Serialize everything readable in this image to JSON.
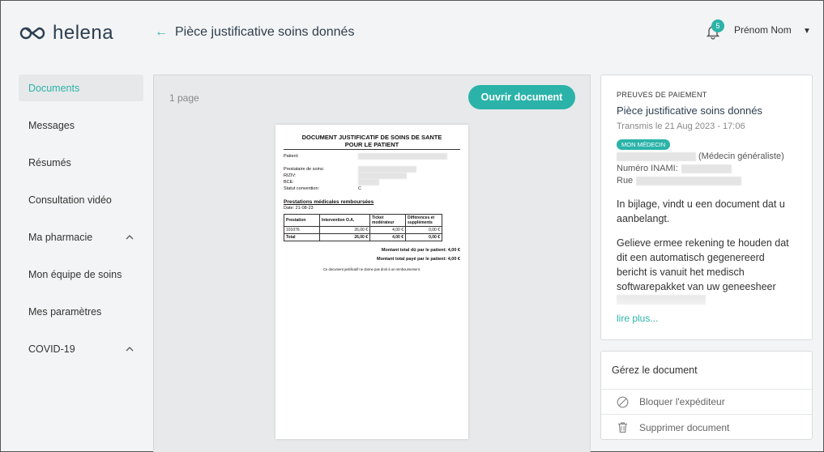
{
  "app": {
    "name": "helena"
  },
  "header": {
    "back_arrow": "←",
    "title": "Pièce justificative soins donnés",
    "notifications": "5",
    "user_name": "Prénom Nom"
  },
  "sidebar": {
    "items": [
      {
        "label": "Documents",
        "active": true
      },
      {
        "label": "Messages"
      },
      {
        "label": "Résumés"
      },
      {
        "label": "Consultation vidéo"
      },
      {
        "label": "Ma pharmacie",
        "expandable": true
      },
      {
        "label": "Mon équipe de soins"
      },
      {
        "label": "Mes paramètres"
      },
      {
        "label": "COVID-19",
        "expandable": true
      }
    ]
  },
  "viewer": {
    "page_count": "1 page",
    "open_button": "Ouvrir document"
  },
  "document": {
    "title_line1": "DOCUMENT JUSTIFICATIF DE SOINS DE SANTE",
    "title_line2": "POUR LE PATIENT",
    "patient_label": "Patient:",
    "provider_label": "Prestataire de soins:",
    "riziv_label": "RIZIV:",
    "bce_label": "BCE:",
    "statut_label": "Statut convention:",
    "statut_value": "C",
    "section_title": "Prestations médicales remboursées",
    "date": "Date: 21-08-23",
    "table": {
      "headers": [
        "Prestation",
        "Intervention O.A.",
        "Ticket modérateur",
        "Différences et suppléments"
      ],
      "rows": [
        [
          "101076",
          "26,00 €",
          "4,00 €",
          "0,00 €"
        ]
      ],
      "total": [
        "Total",
        "26,00 €",
        "4,00 €",
        "0,00 €"
      ]
    },
    "total_due": "Montant total dû par le patient: 4,00 €",
    "total_paid": "Montant total payé par le patient: 4,00 €",
    "note": "Ce document justificatif ne donne pas droit à un remboursement."
  },
  "detail": {
    "label": "PREUVES DE PAIEMENT",
    "title": "Pièce justificative soins donnés",
    "date": "Transmis le 21 Aug 2023 - 17:06",
    "tag": "MON MÉDECIN",
    "doctor_role": "(Médecin généraliste)",
    "inami_label": "Numéro INAMI:",
    "street_label": "Rue",
    "message_p1": "In bijlage, vindt u een document dat u aanbelangt.",
    "message_p2": "Gelieve ermee rekening te houden dat dit een automatisch gegenereerd bericht is vanuit het medisch softwarepakket van uw geneesheer",
    "read_more": "lire plus..."
  },
  "manage": {
    "title": "Gérez le document",
    "block_label": "Bloquer l'expéditeur",
    "delete_label": "Supprimer document"
  },
  "colors": {
    "accent": "#2bb3a9",
    "text_dark": "#2c3e50"
  }
}
